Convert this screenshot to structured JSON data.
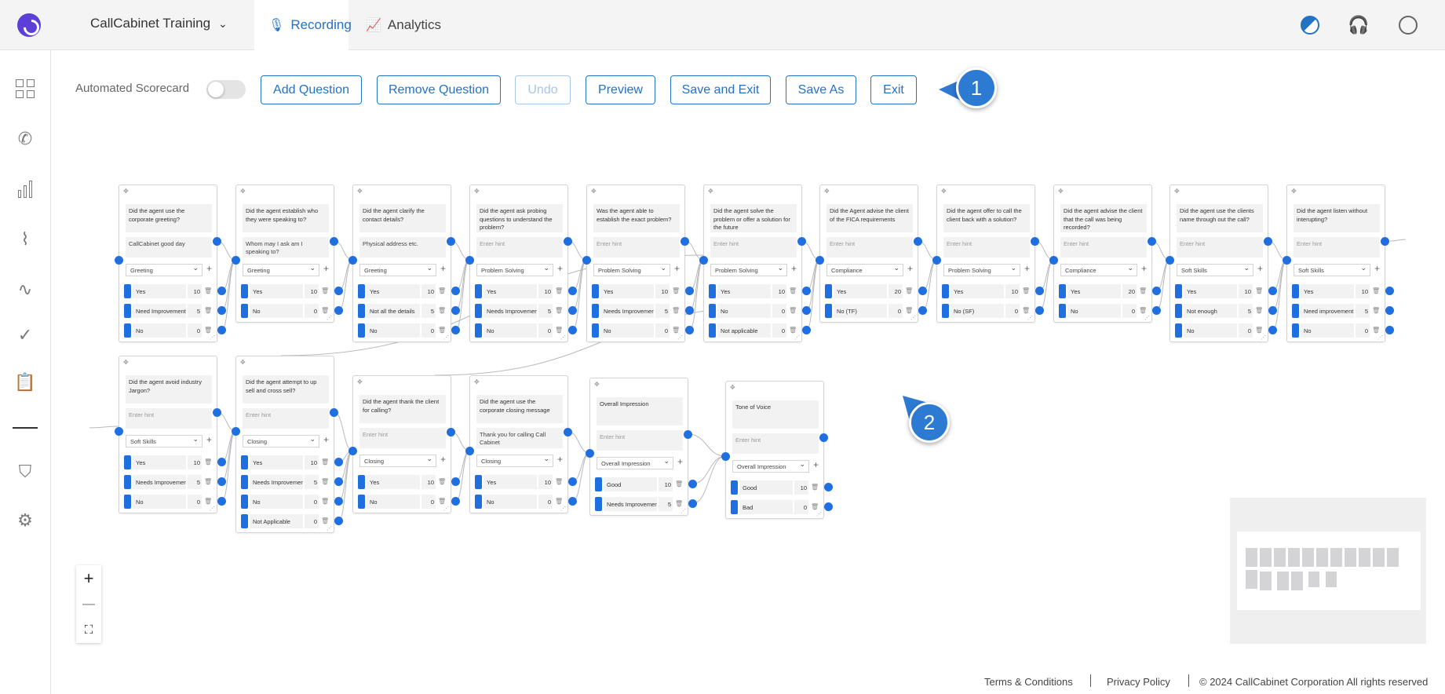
{
  "header": {
    "workspace": "CallCabinet Training",
    "tabs": [
      {
        "label": "Recording",
        "active": true
      },
      {
        "label": "Analytics",
        "active": false
      }
    ],
    "accent_color": "#2372c4"
  },
  "toolbar": {
    "automated_label": "Automated Scorecard",
    "automated_on": false,
    "buttons": {
      "add": "Add Question",
      "remove": "Remove Question",
      "undo": "Undo",
      "preview": "Preview",
      "save_exit": "Save and Exit",
      "save_as": "Save As",
      "exit": "Exit"
    }
  },
  "badges": {
    "one": "1",
    "two": "2"
  },
  "questions": [
    {
      "text": "Did the agent use the corporate greeting?",
      "hint": "CallCabinet good day",
      "category": "Greeting",
      "answers": [
        {
          "label": "Yes",
          "score": "10"
        },
        {
          "label": "Need Improvement",
          "score": "5"
        },
        {
          "label": "No",
          "score": "0"
        }
      ]
    },
    {
      "text": "Did the agent establish who they were speaking to?",
      "hint": "Whom may I ask am I speaking to?",
      "category": "Greeting",
      "answers": [
        {
          "label": "Yes",
          "score": "10"
        },
        {
          "label": "No",
          "score": "0"
        }
      ]
    },
    {
      "text": "Did the agent clarify the contact details?",
      "hint": "Physical address etc.",
      "category": "Greeting",
      "answers": [
        {
          "label": "Yes",
          "score": "10"
        },
        {
          "label": "Not all the details",
          "score": "5"
        },
        {
          "label": "No",
          "score": "0"
        }
      ]
    },
    {
      "text": "Did the agent ask probing questions to understand the problem?",
      "hint": "Enter hint",
      "category": "Problem Solving",
      "answers": [
        {
          "label": "Yes",
          "score": "10"
        },
        {
          "label": "Needs Improvement",
          "score": "5"
        },
        {
          "label": "No",
          "score": "0"
        }
      ]
    },
    {
      "text": "Was the agent able to establish the exact problem?",
      "hint": "Enter hint",
      "category": "Problem Solving",
      "answers": [
        {
          "label": "Yes",
          "score": "10"
        },
        {
          "label": "Needs Improvement",
          "score": "5"
        },
        {
          "label": "No",
          "score": "0"
        }
      ]
    },
    {
      "text": "Did the agent solve the problem or offer a solution for the future",
      "hint": "Enter hint",
      "category": "Problem Solving",
      "answers": [
        {
          "label": "Yes",
          "score": "10"
        },
        {
          "label": "No",
          "score": "0"
        },
        {
          "label": "Not applicable",
          "score": "0"
        }
      ]
    },
    {
      "text": "Did the Agent advise the client of the FICA requirements",
      "hint": "Enter hint",
      "category": "Compliance",
      "answers": [
        {
          "label": "Yes",
          "score": "20"
        },
        {
          "label": "No (TF)",
          "score": "0"
        }
      ]
    },
    {
      "text": "Did the agent offer to call the client back with a solution?",
      "hint": "Enter hint",
      "category": "Problem Solving",
      "answers": [
        {
          "label": "Yes",
          "score": "10"
        },
        {
          "label": "No (SF)",
          "score": "0"
        }
      ]
    },
    {
      "text": "Did the agent advise the client that the call was being recorded?",
      "hint": "Enter hint",
      "category": "Compliance",
      "answers": [
        {
          "label": "Yes",
          "score": "20"
        },
        {
          "label": "No",
          "score": "0"
        }
      ]
    },
    {
      "text": "Did the agent use the clients name through out the call?",
      "hint": "Enter hint",
      "category": "Soft Skills",
      "answers": [
        {
          "label": "Yes",
          "score": "10"
        },
        {
          "label": "Not enough",
          "score": "5"
        },
        {
          "label": "No",
          "score": "0"
        }
      ]
    },
    {
      "text": "Did the agent listen without interupting?",
      "hint": "Enter hint",
      "category": "Soft Skills",
      "answers": [
        {
          "label": "Yes",
          "score": "10"
        },
        {
          "label": "Need improvement",
          "score": "5"
        },
        {
          "label": "No",
          "score": "0"
        }
      ]
    },
    {
      "text": "Did the agent avoid industry Jargon?",
      "hint": "Enter hint",
      "category": "Soft Skills",
      "answers": [
        {
          "label": "Yes",
          "score": "10"
        },
        {
          "label": "Needs Improvement",
          "score": "5"
        },
        {
          "label": "No",
          "score": "0"
        }
      ]
    },
    {
      "text": "Did the agent attempt to up sell and cross sell?",
      "hint": "Enter hint",
      "category": "Closing",
      "answers": [
        {
          "label": "Yes",
          "score": "10"
        },
        {
          "label": "Needs Improvement",
          "score": "5"
        },
        {
          "label": "No",
          "score": "0"
        },
        {
          "label": "Not Applicable",
          "score": "0"
        }
      ]
    },
    {
      "text": "Did the agent thank the client for calling?",
      "hint": "Enter hint",
      "category": "Closing",
      "answers": [
        {
          "label": "Yes",
          "score": "10"
        },
        {
          "label": "No",
          "score": "0"
        }
      ]
    },
    {
      "text": "Did the agent use the corporate closing message",
      "hint": "Thank you for calling Call Cabinet",
      "category": "Closing",
      "answers": [
        {
          "label": "Yes",
          "score": "10"
        },
        {
          "label": "No",
          "score": "0"
        }
      ]
    },
    {
      "text": "Overall Impression",
      "hint": "Enter hint",
      "category": "Overall Impression",
      "answers": [
        {
          "label": "Good",
          "score": "10"
        },
        {
          "label": "Needs Improvement",
          "score": "5"
        }
      ]
    },
    {
      "text": "Tone of Voice",
      "hint": "Enter hint",
      "category": "Overall Impression",
      "answers": [
        {
          "label": "Good",
          "score": "10"
        },
        {
          "label": "Bad",
          "score": "0"
        }
      ]
    }
  ],
  "zoom": {
    "in": "+",
    "out": "—",
    "fit": "⛶"
  },
  "footer": {
    "terms": "Terms & Conditions",
    "privacy": "Privacy Policy",
    "copyright": "© 2024 CallCabinet Corporation All rights reserved"
  }
}
